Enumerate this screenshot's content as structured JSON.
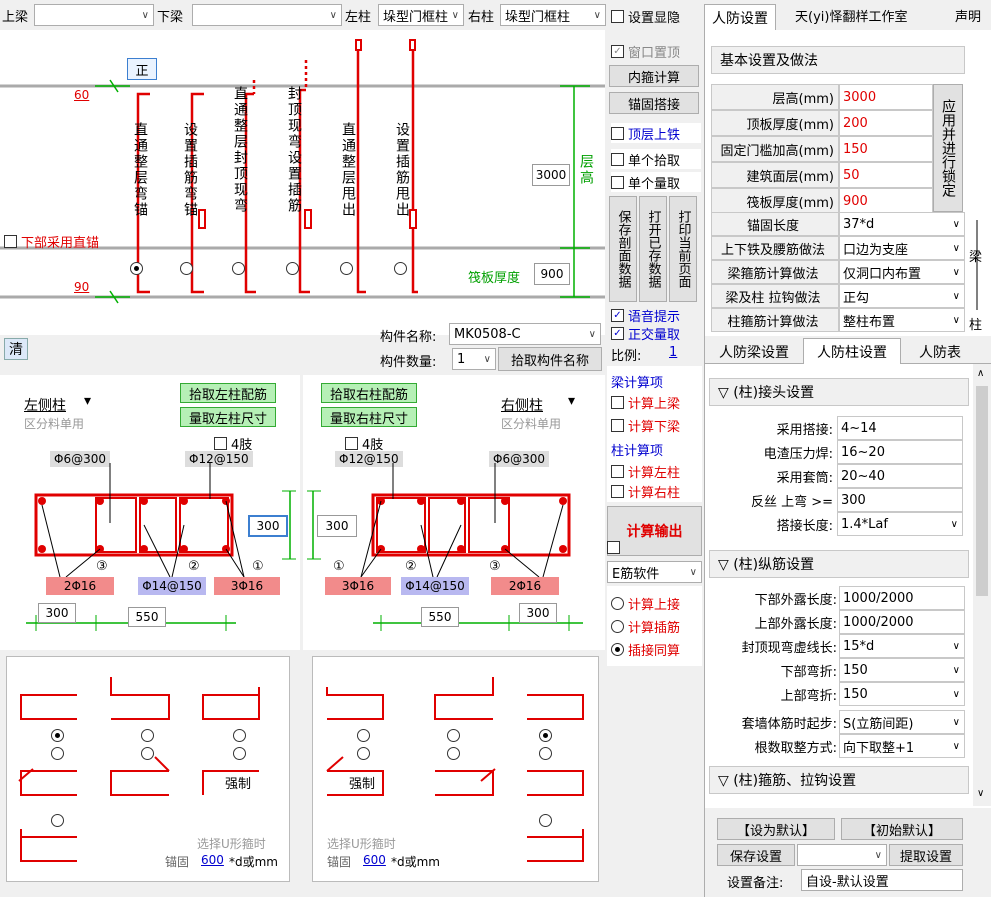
{
  "toolbar": {
    "top_beam_label": "上梁",
    "bottom_beam_label": "下梁",
    "left_col_label": "左柱",
    "left_col_value": "垛型门框柱",
    "right_col_label": "右柱",
    "right_col_value": "垛型门框柱",
    "show_settings": "设置显隐",
    "tab_active": "人防设置",
    "studio": "天(yi)怿翻样工作室",
    "statement": "声明"
  },
  "diagram": {
    "zheng": "正",
    "top_dim": "60",
    "bottom_dim": "90",
    "height_value": "3000",
    "height_label": "层高",
    "slab_label": "筏板厚度",
    "slab_value": "900",
    "lower_straight": "下部采用直锚",
    "options": [
      "直通整层弯锚",
      "设置插筋弯锚",
      "直通整层封顶现弯",
      "封顶现弯设置插筋",
      "直通整层甩出",
      "设置插筋甩出"
    ]
  },
  "clear_btn": "清",
  "component": {
    "name_label": "构件名称:",
    "name_value": "MK0508-C",
    "count_label": "构件数量:",
    "count_value": "1",
    "pick_btn": "拾取构件名称"
  },
  "left_col": {
    "title": "左侧柱",
    "sub": "区分料单用",
    "pick_btn": "拾取左柱配筋",
    "measure_btn": "量取左柱尺寸",
    "four_limb": "4肢",
    "stirrup1": "Φ6@300",
    "stirrup2": "Φ12@150",
    "side_dim": "300",
    "rebar_a": "2Φ16",
    "rebar_b": "Φ14@150",
    "rebar_c": "3Φ16",
    "n1": "③",
    "n2": "②",
    "n3": "①",
    "dim1": "300",
    "dim2": "550"
  },
  "right_col": {
    "title": "右侧柱",
    "sub": "区分料单用",
    "pick_btn": "拾取右柱配筋",
    "measure_btn": "量取右柱尺寸",
    "four_limb": "4肢",
    "stirrup1": "Φ12@150",
    "stirrup2": "Φ6@300",
    "side_dim": "300",
    "rebar_a": "3Φ16",
    "rebar_b": "Φ14@150",
    "rebar_c": "2Φ16",
    "n1": "①",
    "n2": "②",
    "n3": "③",
    "dim1": "550",
    "dim2": "300"
  },
  "hook_panel": {
    "force": "强制",
    "u_hint": "选择U形箍时",
    "anchor_label": "锚固",
    "anchor_value": "600",
    "anchor_unit": "*d或mm"
  },
  "mid": {
    "window_top": "窗口置顶",
    "inner_calc": "内箍计算",
    "anchor_lap": "锚固搭接",
    "top_layer": "顶层上铁",
    "single_pick": "单个拾取",
    "single_measure": "单个量取",
    "save_section": "保存剖面数据",
    "open_saved": "打开已存数据",
    "print_page": "打印当前页面",
    "voice": "语音提示",
    "ortho": "正交量取",
    "scale_label": "比例:",
    "scale_value": "1",
    "beam_calc": "梁计算项",
    "calc_top_beam": "计算上梁",
    "calc_bottom_beam": "计算下梁",
    "col_calc": "柱计算项",
    "calc_left_col": "计算左柱",
    "calc_right_col": "计算右柱",
    "calc_output": "计算输出",
    "software": "E筋软件",
    "r_top_lap": "计算上接",
    "r_dowel": "计算插筋",
    "r_insert": "插接同算"
  },
  "basic": {
    "header": "基本设置及做法",
    "apply_btn": "应用并进行锁定",
    "rows": [
      {
        "label": "层高(mm)",
        "value": "3000"
      },
      {
        "label": "顶板厚度(mm)",
        "value": "200"
      },
      {
        "label": "固定门槛加高(mm)",
        "value": "150"
      },
      {
        "label": "建筑面层(mm)",
        "value": "50"
      },
      {
        "label": "筏板厚度(mm)",
        "value": "900"
      }
    ],
    "selects": [
      {
        "label": "锚固长度",
        "value": "37*d"
      },
      {
        "label": "上下铁及腰筋做法",
        "value": "口边为支座"
      },
      {
        "label": "梁箍筋计算做法",
        "value": "仅洞口内布置"
      },
      {
        "label": "梁及柱 拉钩做法",
        "value": "正勾"
      },
      {
        "label": "柱箍筋计算做法",
        "value": "整柱布置"
      }
    ],
    "side_beam": "梁",
    "side_col": "柱"
  },
  "tabs2": [
    "人防梁设置",
    "人防柱设置",
    "人防表"
  ],
  "col_settings": {
    "sec1": "▽ (柱)接头设置",
    "lap_rows": [
      {
        "label": "采用搭接:",
        "value": "4~14"
      },
      {
        "label": "电渣压力焊:",
        "value": "16~20"
      },
      {
        "label": "采用套筒:",
        "value": "20~40"
      },
      {
        "label": "反丝  上弯 >=",
        "value": "300"
      },
      {
        "label": "搭接长度:",
        "value": "1.4*Laf"
      }
    ],
    "sec2": "▽ (柱)纵筋设置",
    "long_rows": [
      {
        "label": "下部外露长度:",
        "value": "1000/2000"
      },
      {
        "label": "上部外露长度:",
        "value": "1000/2000"
      },
      {
        "label": "封顶现弯虚线长:",
        "value": "15*d"
      },
      {
        "label": "下部弯折:",
        "value": "150"
      },
      {
        "label": "上部弯折:",
        "value": "150"
      },
      {
        "label": "套墙体筋时起步:",
        "value": "S(立筋间距)"
      },
      {
        "label": "根数取整方式:",
        "value": "向下取整+1"
      }
    ],
    "sec3": "▽ (柱)箍筋、拉钩设置"
  },
  "bottom": {
    "set_default": "【设为默认】",
    "init_default": "【初始默认】",
    "save_settings": "保存设置",
    "fetch_settings": "提取设置",
    "remark_label": "设置备注:",
    "remark_value": "自设-默认设置"
  }
}
